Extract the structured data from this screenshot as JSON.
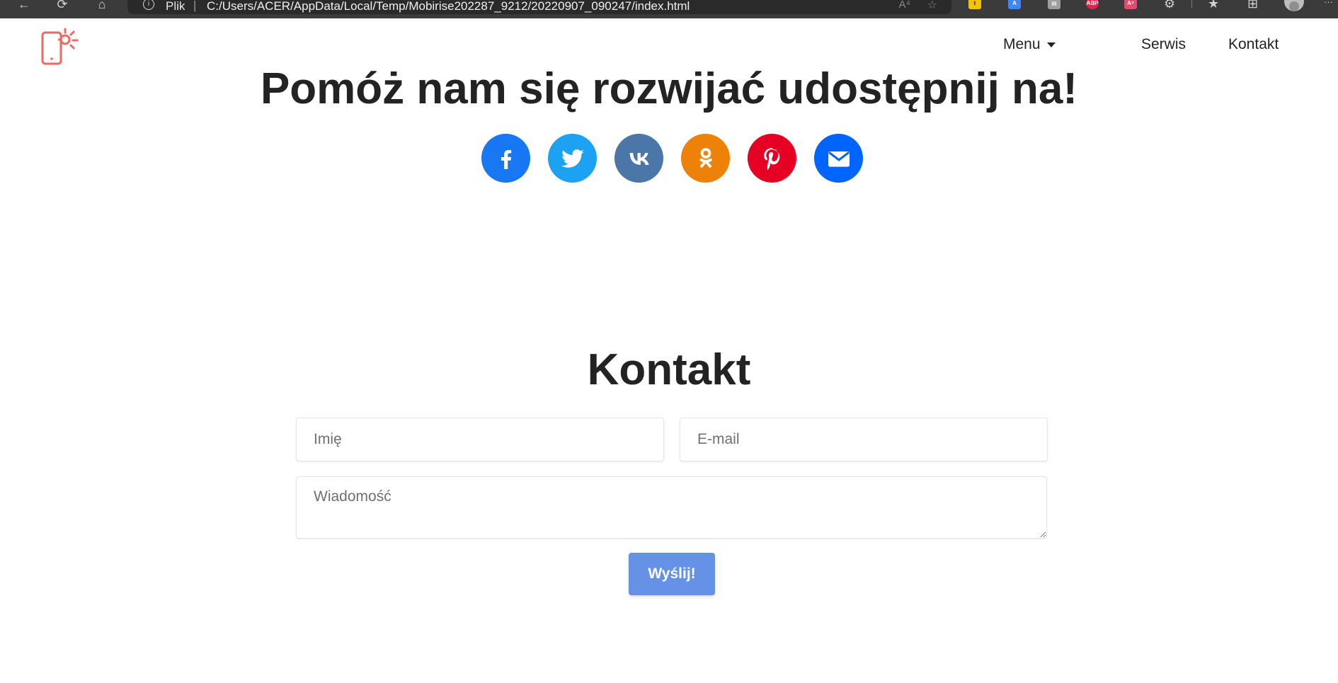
{
  "browser": {
    "address_label": "Plik",
    "address_separator": "|",
    "url": "C:/Users/ACER/AppData/Local/Temp/Mobirise202287_9212/20220907_090247/index.html",
    "read_aloud_glyph": "A⁴",
    "extensions": [
      {
        "name": "translate-extension",
        "badge": "A",
        "color": "#4285f4"
      },
      {
        "name": "adblock-plus-extension",
        "badge": "ABP",
        "color": "#e4234a"
      },
      {
        "name": "pdf-extension",
        "badge": "A⁴",
        "color": "#e24b6b"
      }
    ],
    "more_glyph": "···"
  },
  "navbar": {
    "menu_label": "Menu",
    "links": [
      "Serwis",
      "Kontakt"
    ],
    "logo_color": "#f06860"
  },
  "share": {
    "title": "Pomóż nam się rozwijać udostępnij na!",
    "networks": [
      {
        "name": "facebook",
        "color": "#1877f2"
      },
      {
        "name": "twitter",
        "color": "#1da1f2"
      },
      {
        "name": "vk",
        "color": "#4a76a8"
      },
      {
        "name": "odnoklassniki",
        "color": "#ee8208"
      },
      {
        "name": "pinterest",
        "color": "#e60023"
      },
      {
        "name": "email",
        "color": "#0065ff"
      }
    ]
  },
  "contact": {
    "title": "Kontakt",
    "name_placeholder": "Imię",
    "email_placeholder": "E-mail",
    "message_placeholder": "Wiadomość",
    "submit_label": "Wyślij!",
    "submit_color": "#6592e6"
  }
}
